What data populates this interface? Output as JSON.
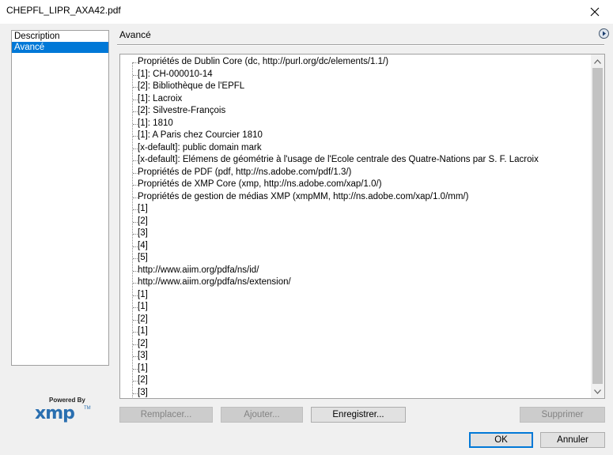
{
  "window": {
    "title": "CHEPFL_LIPR_AXA42.pdf"
  },
  "nav": {
    "items": [
      "Description",
      "Avancé"
    ],
    "selected": 1
  },
  "logo": {
    "powered": "Powered By",
    "word": "xmp",
    "tm": "TM"
  },
  "panel": {
    "title": "Avancé"
  },
  "tree": {
    "rows": [
      "Propriétés de Dublin Core (dc, http://purl.org/dc/elements/1.1/)",
      "[1]: CH-000010-14",
      "[2]: Bibliothèque de l'EPFL",
      "[1]: Lacroix",
      "[2]: Silvestre-François",
      "[1]: 1810",
      "[1]: A Paris chez Courcier 1810",
      "[x-default]: public domain mark",
      "[x-default]: Elémens de géométrie à l'usage de l'Ecole centrale des Quatre-Nations par S. F. Lacroix",
      "Propriétés de PDF (pdf, http://ns.adobe.com/pdf/1.3/)",
      "Propriétés de XMP Core (xmp, http://ns.adobe.com/xap/1.0/)",
      "Propriétés de gestion de médias XMP (xmpMM, http://ns.adobe.com/xap/1.0/mm/)",
      "[1]",
      "[2]",
      "[3]",
      "[4]",
      "[5]",
      "http://www.aiim.org/pdfa/ns/id/",
      "http://www.aiim.org/pdfa/ns/extension/",
      "[1]",
      "[1]",
      "[2]",
      "[1]",
      "[2]",
      "[3]",
      "[1]",
      "[2]",
      "[3]"
    ]
  },
  "buttons": {
    "replace": "Remplacer...",
    "append": "Ajouter...",
    "save": "Enregistrer...",
    "delete": "Supprimer",
    "ok": "OK",
    "cancel": "Annuler"
  }
}
